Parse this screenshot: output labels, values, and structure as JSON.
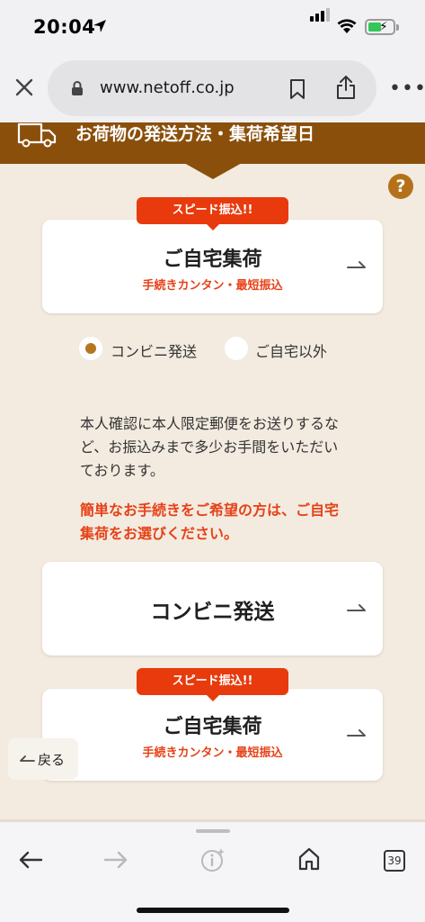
{
  "status_bar": {
    "time": "20:04"
  },
  "browser": {
    "url": "www.netoff.co.jp",
    "more_label": "•••"
  },
  "header": {
    "title": "お荷物の発送方法・集荷希望日",
    "help_label": "?"
  },
  "card_top": {
    "badge": "スピード振込!!",
    "title": "ご自宅集荷",
    "subtitle": "手続きカンタン・最短振込"
  },
  "radio_options": [
    {
      "label": "コンビニ発送",
      "selected": true
    },
    {
      "label": "ご自宅以外",
      "selected": false
    }
  ],
  "description": "本人確認に本人限定郵便をお送りするなど、お振込みまで多少お手間をいただいております。",
  "notice": "簡単なお手続きをご希望の方は、ご自宅集荷をお選びください。",
  "card_conbini": {
    "title": "コンビニ発送"
  },
  "card_bottom": {
    "badge": "スピード振込!!",
    "title": "ご自宅集荷",
    "subtitle": "手続きカンタン・最短振込"
  },
  "back_button": {
    "label": "戻る"
  },
  "toolbar": {
    "tab_count": "39"
  },
  "colors": {
    "header_brown": "#8a4f0b",
    "page_bg": "#f3ebe0",
    "accent_red": "#e64218",
    "badge_red": "#e83a0c",
    "radio_gold": "#b5771e"
  }
}
